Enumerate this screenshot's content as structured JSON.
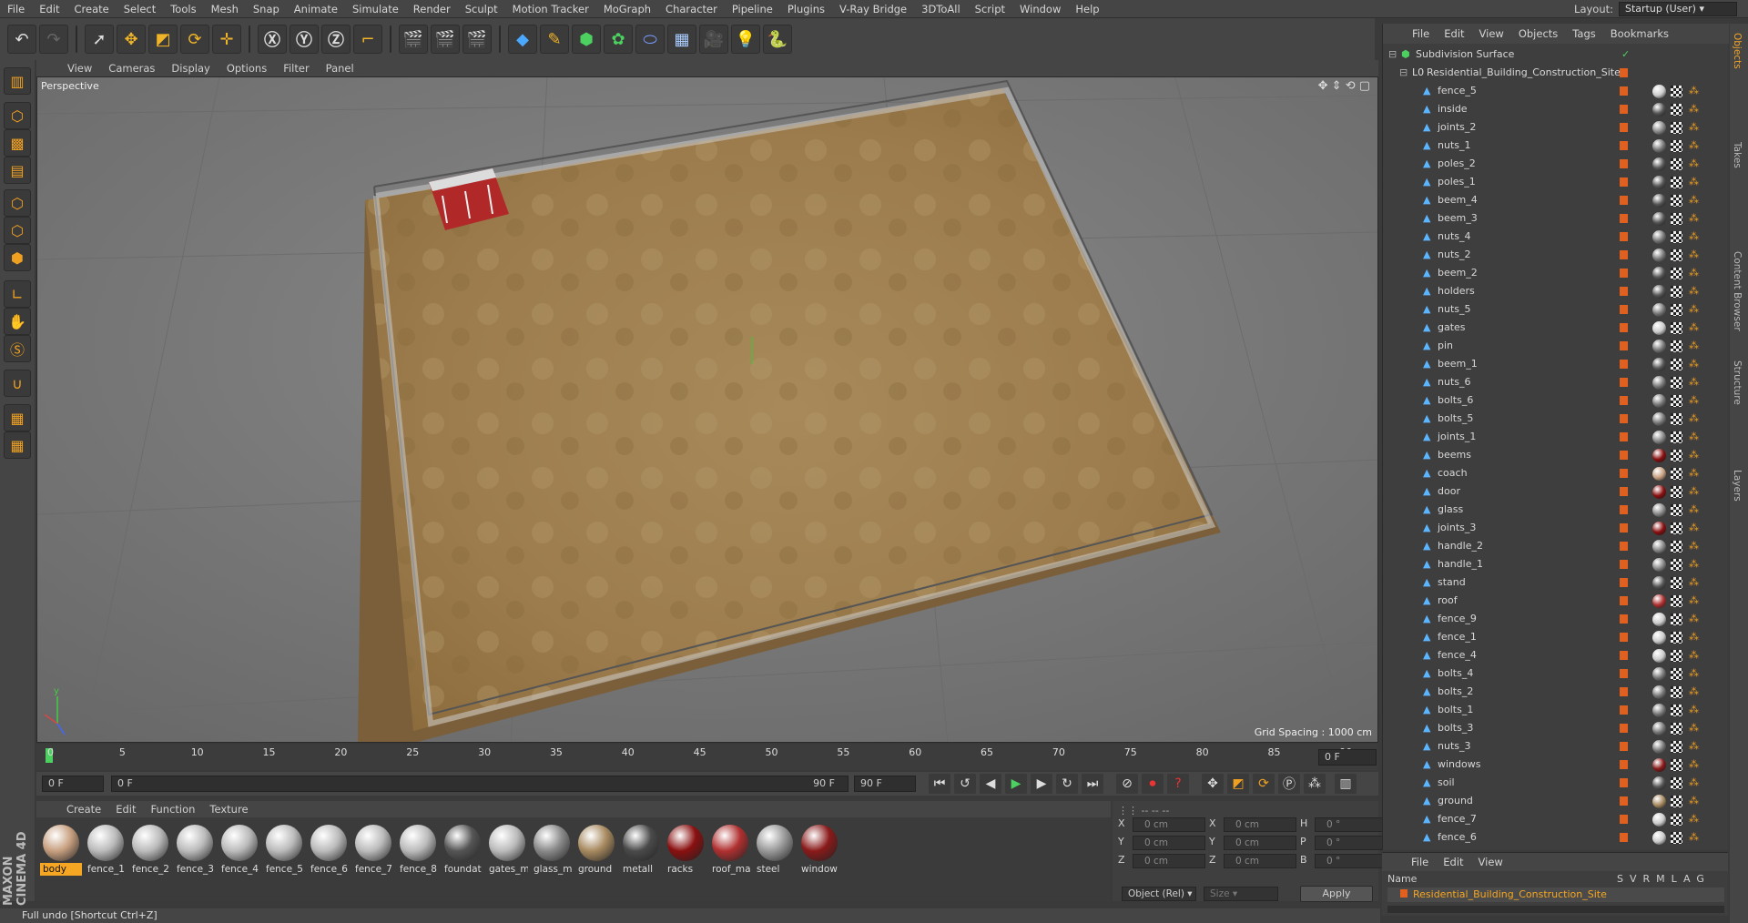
{
  "menubar": {
    "items": [
      "File",
      "Edit",
      "Create",
      "Select",
      "Tools",
      "Mesh",
      "Snap",
      "Animate",
      "Simulate",
      "Render",
      "Sculpt",
      "Motion Tracker",
      "MoGraph",
      "Character",
      "Pipeline",
      "Plugins",
      "V-Ray Bridge",
      "3DToAll",
      "Script",
      "Window",
      "Help"
    ],
    "layout_label": "Layout:",
    "layout_value": "Startup (User)"
  },
  "viewport": {
    "menu": [
      "View",
      "Cameras",
      "Display",
      "Options",
      "Filter",
      "Panel"
    ],
    "label": "Perspective",
    "grid_spacing": "Grid Spacing : 1000 cm"
  },
  "timeline": {
    "ticks": [
      "0",
      "5",
      "10",
      "15",
      "20",
      "25",
      "30",
      "35",
      "40",
      "45",
      "50",
      "55",
      "60",
      "65",
      "70",
      "75",
      "80",
      "85",
      "90"
    ],
    "current_frame": "0 F",
    "start_field": "0 F",
    "slider_start": "0 F",
    "slider_end": "90 F",
    "end_field": "90 F",
    "right_field": "0 F"
  },
  "materials": {
    "menu": [
      "Create",
      "Edit",
      "Function",
      "Texture"
    ],
    "items": [
      {
        "name": "body",
        "color": "#c8a080"
      },
      {
        "name": "fence_1",
        "color": "#bbbbbb"
      },
      {
        "name": "fence_2",
        "color": "#bbbbbb"
      },
      {
        "name": "fence_3",
        "color": "#bbbbbb"
      },
      {
        "name": "fence_4",
        "color": "#bbbbbb"
      },
      {
        "name": "fence_5",
        "color": "#bbbbbb"
      },
      {
        "name": "fence_6",
        "color": "#bbbbbb"
      },
      {
        "name": "fence_7",
        "color": "#bbbbbb"
      },
      {
        "name": "fence_8",
        "color": "#bbbbbb"
      },
      {
        "name": "foundat",
        "color": "#555555"
      },
      {
        "name": "gates_m",
        "color": "#bbbbbb"
      },
      {
        "name": "glass_m",
        "color": "#8a8a8a"
      },
      {
        "name": "ground",
        "color": "#a88a60"
      },
      {
        "name": "metall",
        "color": "#4a4a4a"
      },
      {
        "name": "racks",
        "color": "#8a1010"
      },
      {
        "name": "roof_ma",
        "color": "#b03030"
      },
      {
        "name": "steel",
        "color": "#999999"
      },
      {
        "name": "window",
        "color": "#8a1a1a"
      }
    ]
  },
  "coords": {
    "rows": [
      {
        "a": "X",
        "av": "0 cm",
        "b": "X",
        "bv": "0 cm",
        "c": "H",
        "cv": "0 °"
      },
      {
        "a": "Y",
        "av": "0 cm",
        "b": "Y",
        "bv": "0 cm",
        "c": "P",
        "cv": "0 °"
      },
      {
        "a": "Z",
        "av": "0 cm",
        "b": "Z",
        "bv": "0 cm",
        "c": "B",
        "cv": "0 °"
      }
    ],
    "mode": "Object (Rel)",
    "size": "Size",
    "apply": "Apply"
  },
  "object_manager": {
    "menu": [
      "File",
      "Edit",
      "View",
      "Objects",
      "Tags",
      "Bookmarks"
    ],
    "root": "Subdivision Surface",
    "group": "Residential_Building_Construction_Site",
    "objects": [
      {
        "name": "fence_5",
        "mat": "#cccccc"
      },
      {
        "name": "inside",
        "mat": "#555555"
      },
      {
        "name": "joints_2",
        "mat": "#888888"
      },
      {
        "name": "nuts_1",
        "mat": "#777777"
      },
      {
        "name": "poles_2",
        "mat": "#555555"
      },
      {
        "name": "poles_1",
        "mat": "#555555"
      },
      {
        "name": "beem_4",
        "mat": "#555555"
      },
      {
        "name": "beem_3",
        "mat": "#555555"
      },
      {
        "name": "nuts_4",
        "mat": "#777777"
      },
      {
        "name": "nuts_2",
        "mat": "#777777"
      },
      {
        "name": "beem_2",
        "mat": "#555555"
      },
      {
        "name": "holders",
        "mat": "#555555"
      },
      {
        "name": "nuts_5",
        "mat": "#777777"
      },
      {
        "name": "gates",
        "mat": "#cccccc"
      },
      {
        "name": "pin",
        "mat": "#777777"
      },
      {
        "name": "beem_1",
        "mat": "#555555"
      },
      {
        "name": "nuts_6",
        "mat": "#777777"
      },
      {
        "name": "bolts_6",
        "mat": "#777777"
      },
      {
        "name": "bolts_5",
        "mat": "#777777"
      },
      {
        "name": "joints_1",
        "mat": "#888888"
      },
      {
        "name": "beems",
        "mat": "#8a1010"
      },
      {
        "name": "coach",
        "mat": "#c8a080"
      },
      {
        "name": "door",
        "mat": "#8a1010"
      },
      {
        "name": "glass",
        "mat": "#8a8a8a"
      },
      {
        "name": "joints_3",
        "mat": "#8a1010"
      },
      {
        "name": "handle_2",
        "mat": "#888888"
      },
      {
        "name": "handle_1",
        "mat": "#888888"
      },
      {
        "name": "stand",
        "mat": "#555555"
      },
      {
        "name": "roof",
        "mat": "#b03030"
      },
      {
        "name": "fence_9",
        "mat": "#cccccc"
      },
      {
        "name": "fence_1",
        "mat": "#cccccc"
      },
      {
        "name": "fence_4",
        "mat": "#cccccc"
      },
      {
        "name": "bolts_4",
        "mat": "#777777"
      },
      {
        "name": "bolts_2",
        "mat": "#777777"
      },
      {
        "name": "bolts_1",
        "mat": "#777777"
      },
      {
        "name": "bolts_3",
        "mat": "#777777"
      },
      {
        "name": "nuts_3",
        "mat": "#777777"
      },
      {
        "name": "windows",
        "mat": "#8a1a1a"
      },
      {
        "name": "soil",
        "mat": "#555555"
      },
      {
        "name": "ground",
        "mat": "#a88a60"
      },
      {
        "name": "fence_7",
        "mat": "#cccccc"
      },
      {
        "name": "fence_6",
        "mat": "#cccccc"
      }
    ]
  },
  "layers": {
    "menu": [
      "File",
      "Edit",
      "View"
    ],
    "header_name": "Name",
    "header_cols": [
      "S",
      "V",
      "R",
      "M",
      "L",
      "A",
      "G"
    ],
    "row": "Residential_Building_Construction_Site"
  },
  "side_tabs": [
    "Objects",
    "Takes",
    "Content Browser",
    "Structure",
    "Layers"
  ],
  "status": "Full undo [Shortcut Ctrl+Z]",
  "brand": "MAXON CINEMA 4D"
}
